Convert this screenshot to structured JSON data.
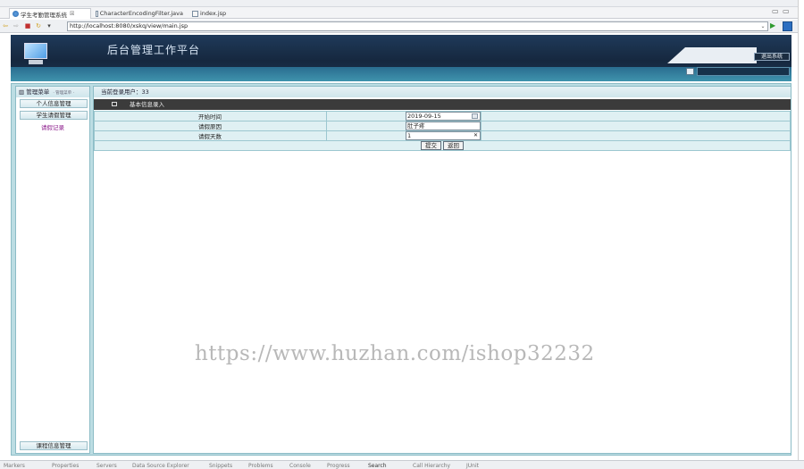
{
  "tabs": [
    {
      "label": "学生考勤管理系统",
      "close": "☒"
    },
    {
      "label": "CharacterEncodingFilter.java",
      "close": ""
    },
    {
      "label": "index.jsp",
      "close": ""
    }
  ],
  "window_controls": {
    "minimize": "▭",
    "maximize": "▭"
  },
  "address": {
    "url": "http://localhost:8080/xskq/view/main.jsp"
  },
  "app": {
    "title": "后台管理工作平台",
    "logout": "退出系统"
  },
  "sidebar": {
    "header": "管理菜单",
    "header_sub": "· 管理菜单 ·",
    "items": [
      {
        "label": "个人信息管理"
      },
      {
        "label": "学生请假管理"
      }
    ],
    "sub_link": "请假记录",
    "bottom_button": "课程信息管理"
  },
  "main": {
    "current_user": "当前登录用户：33",
    "section_title": "基本信息录入",
    "fields": [
      {
        "label": "开始时间",
        "value": "2019-09-15"
      },
      {
        "label": "请假原因",
        "value": "肚子疼"
      },
      {
        "label": "请假天数",
        "value": "1"
      }
    ],
    "submit": "提交",
    "back": "返回"
  },
  "watermark": "https://www.huzhan.com/ishop32232",
  "bottom_tabs": [
    "Markers",
    "Properties",
    "Servers",
    "Data Source Explorer",
    "Snippets",
    "Problems",
    "Console",
    "Progress",
    "Search",
    "Call Hierarchy",
    "JUnit"
  ]
}
